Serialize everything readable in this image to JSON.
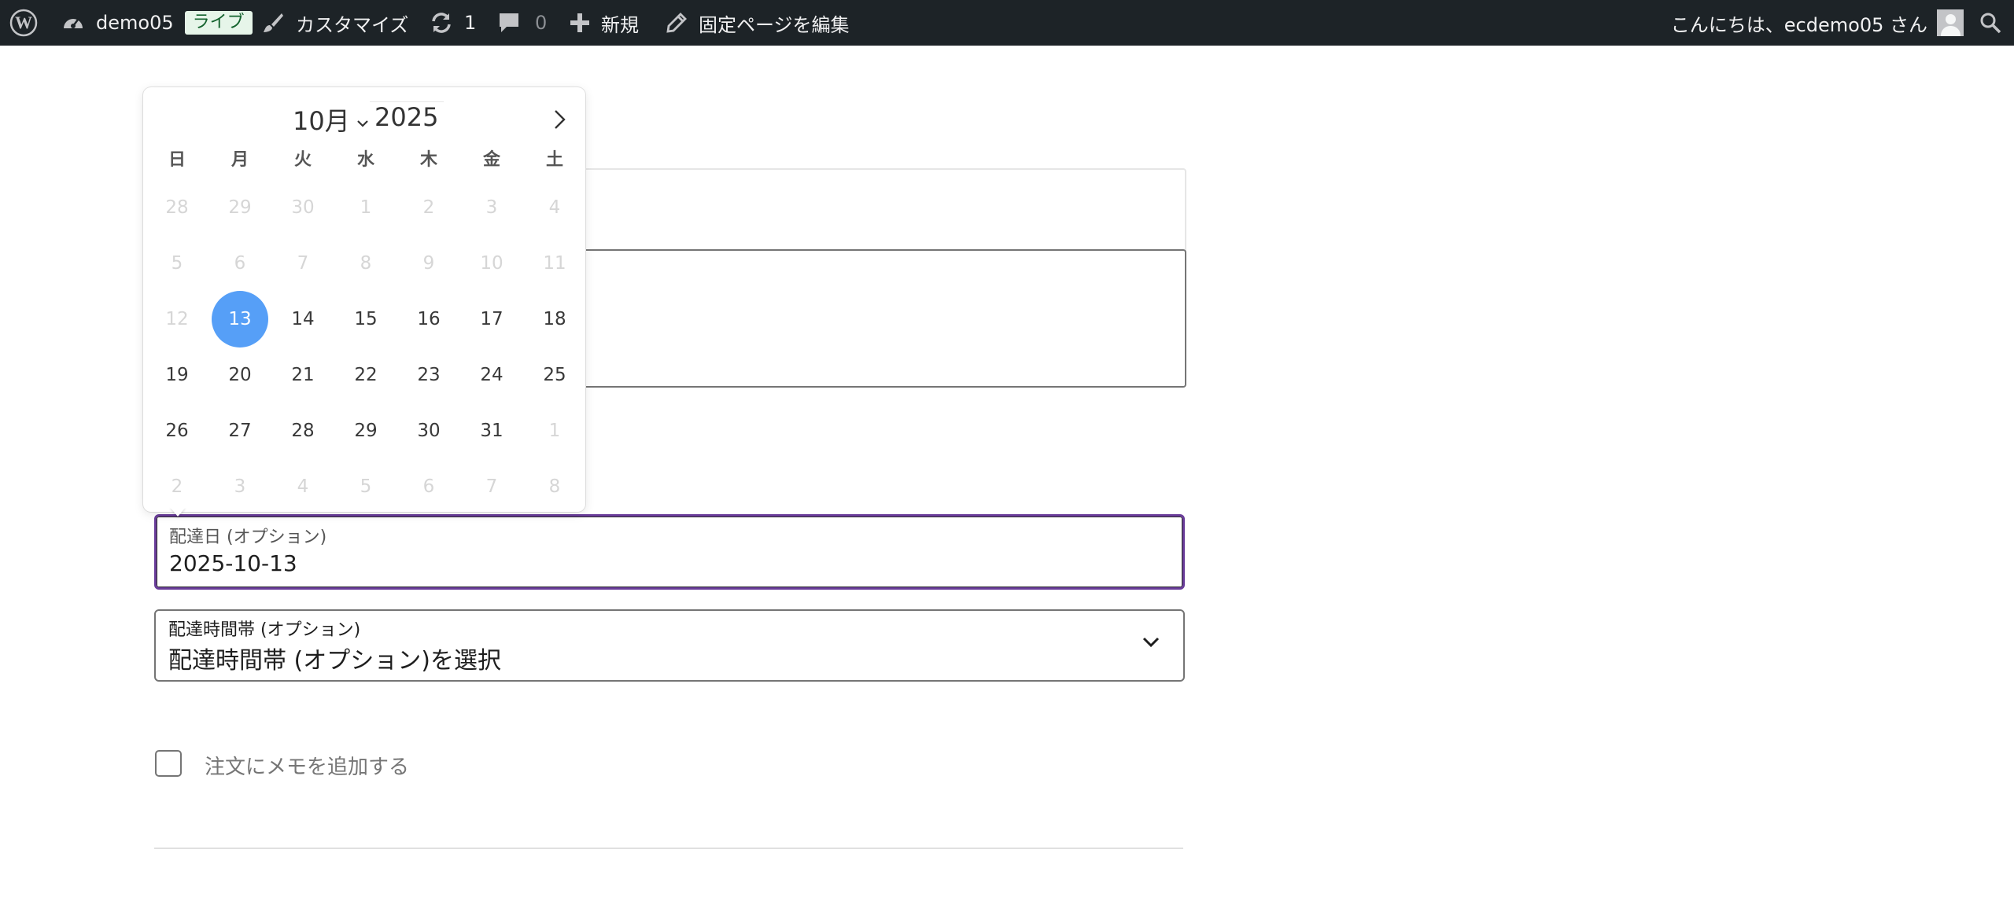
{
  "admin_bar": {
    "site_name": "demo05",
    "live_badge": "ライブ",
    "customize": "カスタマイズ",
    "updates_count": "1",
    "comments_count": "0",
    "new": "新規",
    "edit_page": "固定ページを編集",
    "greeting": "こんにちは、ecdemo05 さん"
  },
  "calendar": {
    "month_label": "10月",
    "year": "2025",
    "weekdays": [
      "日",
      "月",
      "火",
      "水",
      "木",
      "金",
      "土"
    ],
    "weeks": [
      [
        {
          "d": "28",
          "s": "dis"
        },
        {
          "d": "29",
          "s": "dis"
        },
        {
          "d": "30",
          "s": "dis"
        },
        {
          "d": "1",
          "s": "dis"
        },
        {
          "d": "2",
          "s": "dis"
        },
        {
          "d": "3",
          "s": "dis"
        },
        {
          "d": "4",
          "s": "dis"
        }
      ],
      [
        {
          "d": "5",
          "s": "dis"
        },
        {
          "d": "6",
          "s": "dis"
        },
        {
          "d": "7",
          "s": "dis"
        },
        {
          "d": "8",
          "s": "dis"
        },
        {
          "d": "9",
          "s": "dis"
        },
        {
          "d": "10",
          "s": "dis"
        },
        {
          "d": "11",
          "s": "dis"
        }
      ],
      [
        {
          "d": "12",
          "s": "dis"
        },
        {
          "d": "13",
          "s": "sel"
        },
        {
          "d": "14",
          "s": "cur"
        },
        {
          "d": "15",
          "s": "cur"
        },
        {
          "d": "16",
          "s": "cur"
        },
        {
          "d": "17",
          "s": "cur"
        },
        {
          "d": "18",
          "s": "cur"
        }
      ],
      [
        {
          "d": "19",
          "s": "cur"
        },
        {
          "d": "20",
          "s": "cur"
        },
        {
          "d": "21",
          "s": "cur"
        },
        {
          "d": "22",
          "s": "cur"
        },
        {
          "d": "23",
          "s": "cur"
        },
        {
          "d": "24",
          "s": "cur"
        },
        {
          "d": "25",
          "s": "cur"
        }
      ],
      [
        {
          "d": "26",
          "s": "cur"
        },
        {
          "d": "27",
          "s": "cur"
        },
        {
          "d": "28",
          "s": "cur"
        },
        {
          "d": "29",
          "s": "cur"
        },
        {
          "d": "30",
          "s": "cur"
        },
        {
          "d": "31",
          "s": "cur"
        },
        {
          "d": "1",
          "s": "dis"
        }
      ],
      [
        {
          "d": "2",
          "s": "dis"
        },
        {
          "d": "3",
          "s": "dis"
        },
        {
          "d": "4",
          "s": "dis"
        },
        {
          "d": "5",
          "s": "dis"
        },
        {
          "d": "6",
          "s": "dis"
        },
        {
          "d": "7",
          "s": "dis"
        },
        {
          "d": "8",
          "s": "dis"
        }
      ]
    ]
  },
  "form": {
    "delivery_date_label": "配達日 (オプション)",
    "delivery_date_value": "2025-10-13",
    "delivery_time_label": "配達時間帯 (オプション)",
    "delivery_time_value": "配達時間帯 (オプション)を選択",
    "order_note_label": "注文にメモを追加する"
  },
  "colors": {
    "admin_bar_bg": "#1d2327",
    "selected_day": "#569ff7",
    "focus_border": "#6a3d9a"
  }
}
